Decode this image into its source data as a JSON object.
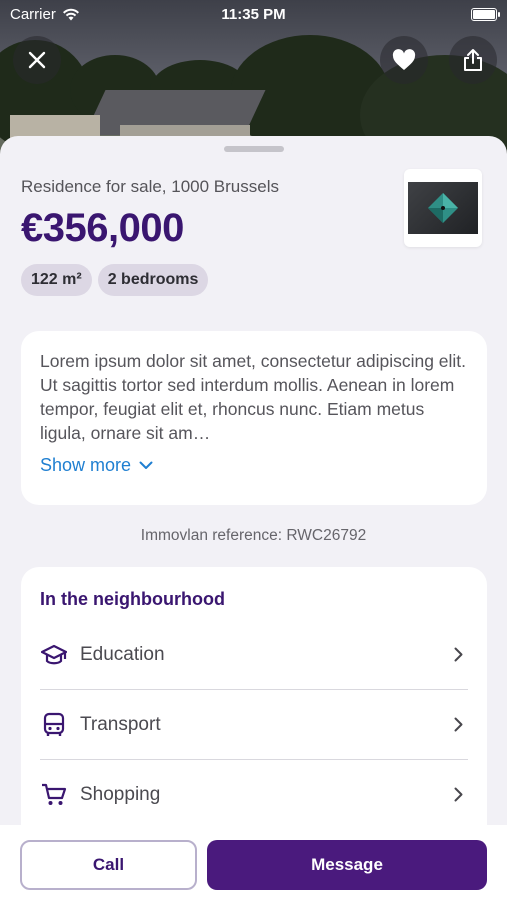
{
  "status_bar": {
    "carrier": "Carrier",
    "time": "11:35 PM"
  },
  "listing": {
    "subtitle": "Residence for sale, 1000 Brussels",
    "price": "€356,000",
    "area": "122 m²",
    "bedrooms": "2 bedrooms"
  },
  "description": {
    "text": "Lorem ipsum dolor sit amet, consectetur adipiscing elit. Ut sagittis tortor sed interdum mollis. Aenean in lorem tempor, feugiat elit et, rhoncus nunc. Etiam metus ligula, ornare sit am…",
    "show_more": "Show more"
  },
  "reference": "Immovlan reference: RWC26792",
  "neighbourhood": {
    "title": "In the neighbourhood",
    "items": [
      {
        "label": "Education",
        "icon": "graduation-cap-icon"
      },
      {
        "label": "Transport",
        "icon": "bus-icon"
      },
      {
        "label": "Shopping",
        "icon": "shopping-cart-icon"
      }
    ]
  },
  "actions": {
    "call": "Call",
    "message": "Message"
  },
  "colors": {
    "brand": "#3a1670",
    "button": "#4a1a7d",
    "link": "#1f7fd1"
  }
}
